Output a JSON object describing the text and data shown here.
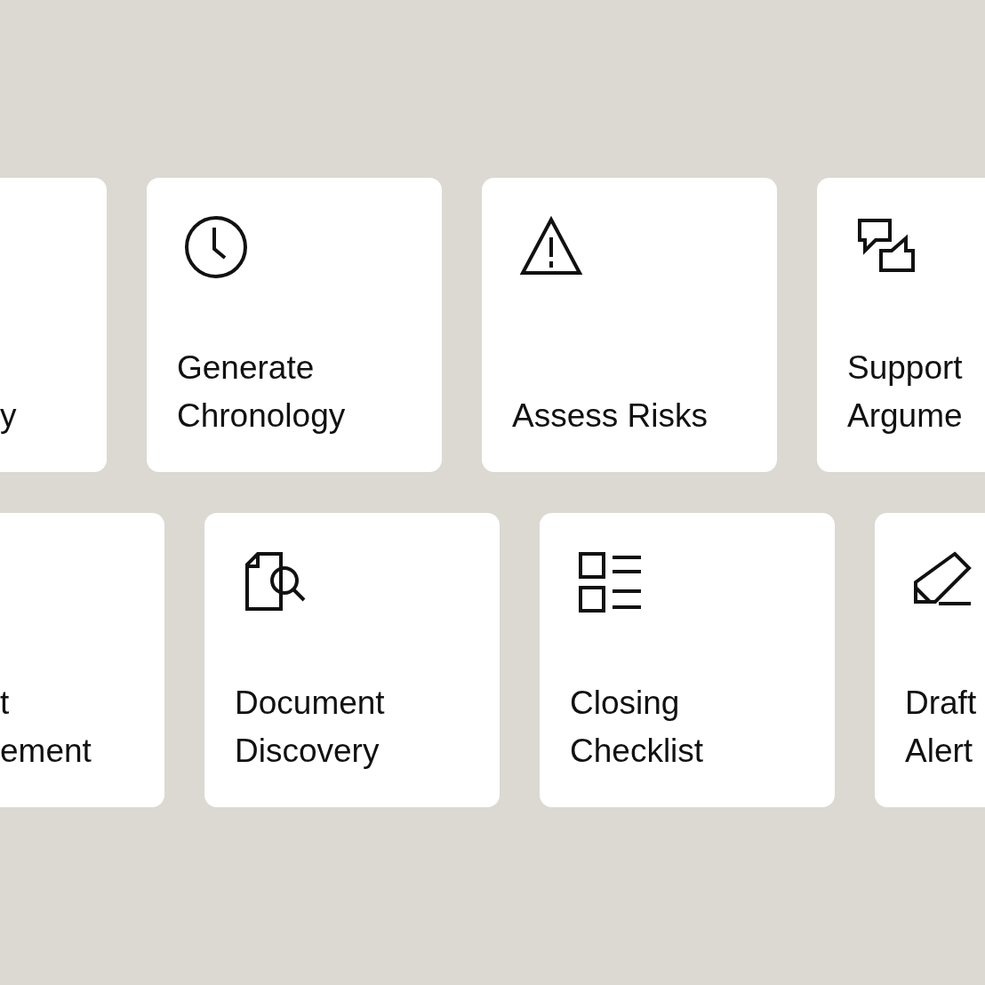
{
  "rows": [
    {
      "cards": [
        {
          "lines": [
            "y"
          ]
        },
        {
          "lines": [
            "Generate",
            "Chronology"
          ]
        },
        {
          "lines": [
            "Assess Risks"
          ]
        },
        {
          "lines": [
            "Support",
            "Argume"
          ]
        }
      ]
    },
    {
      "cards": [
        {
          "lines": [
            "t",
            "ement"
          ]
        },
        {
          "lines": [
            "Document",
            "Discovery"
          ]
        },
        {
          "lines": [
            "Closing",
            "Checklist"
          ]
        },
        {
          "lines": [
            "Draft",
            "Alert"
          ]
        }
      ]
    }
  ]
}
